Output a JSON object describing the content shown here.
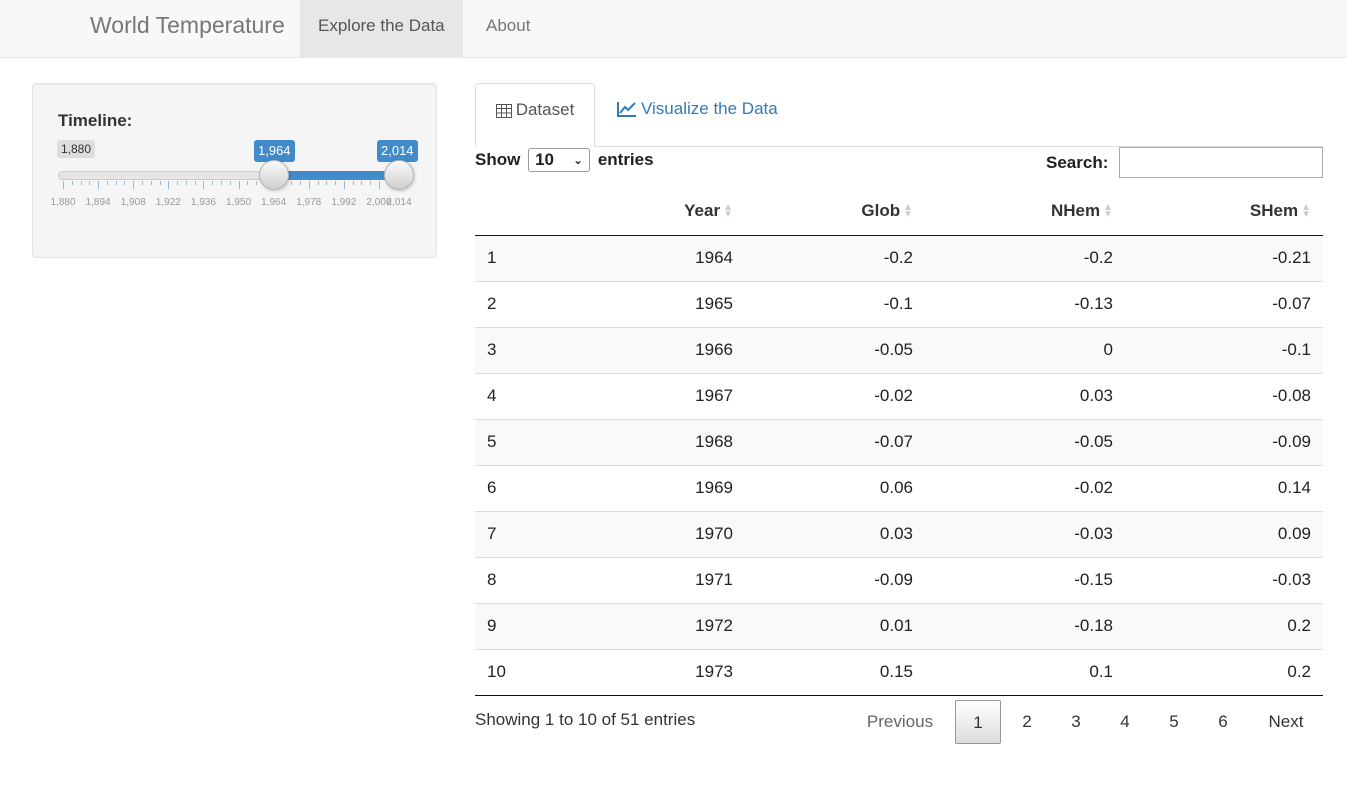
{
  "nav": {
    "brand": "World Temperature",
    "items": [
      "Explore the Data",
      "About"
    ],
    "active": "Explore the Data"
  },
  "sidebar": {
    "label": "Timeline:",
    "min_label": "1,880",
    "handle_low_label": "1,964",
    "handle_high_label": "2,014",
    "range": {
      "min": 1880,
      "max": 2014,
      "from": 1964,
      "to": 2014
    },
    "grid_labels": [
      "1,880",
      "1,894",
      "1,908",
      "1,922",
      "1,936",
      "1,950",
      "1,964",
      "1,978",
      "1,992",
      "2,006",
      "2,014"
    ],
    "accent": "#428bca"
  },
  "tabs": {
    "dataset": "Dataset",
    "visualize": "Visualize the Data",
    "dataset_icon": "table-icon",
    "visualize_icon": "line-chart-icon"
  },
  "table": {
    "show_label": "Show",
    "length_value": "10",
    "entries_label": "entries",
    "search_label": "Search:",
    "search_value": "",
    "columns": [
      "",
      "Year",
      "Glob",
      "NHem",
      "SHem"
    ],
    "rows": [
      [
        "1",
        "1964",
        "-0.2",
        "-0.2",
        "-0.21"
      ],
      [
        "2",
        "1965",
        "-0.1",
        "-0.13",
        "-0.07"
      ],
      [
        "3",
        "1966",
        "-0.05",
        "0",
        "-0.1"
      ],
      [
        "4",
        "1967",
        "-0.02",
        "0.03",
        "-0.08"
      ],
      [
        "5",
        "1968",
        "-0.07",
        "-0.05",
        "-0.09"
      ],
      [
        "6",
        "1969",
        "0.06",
        "-0.02",
        "0.14"
      ],
      [
        "7",
        "1970",
        "0.03",
        "-0.03",
        "0.09"
      ],
      [
        "8",
        "1971",
        "-0.09",
        "-0.15",
        "-0.03"
      ],
      [
        "9",
        "1972",
        "0.01",
        "-0.18",
        "0.2"
      ],
      [
        "10",
        "1973",
        "0.15",
        "0.1",
        "0.2"
      ]
    ],
    "info": "Showing 1 to 10 of 51 entries",
    "pagination": {
      "previous": "Previous",
      "pages": [
        "1",
        "2",
        "3",
        "4",
        "5",
        "6"
      ],
      "current": "1",
      "next": "Next"
    }
  }
}
